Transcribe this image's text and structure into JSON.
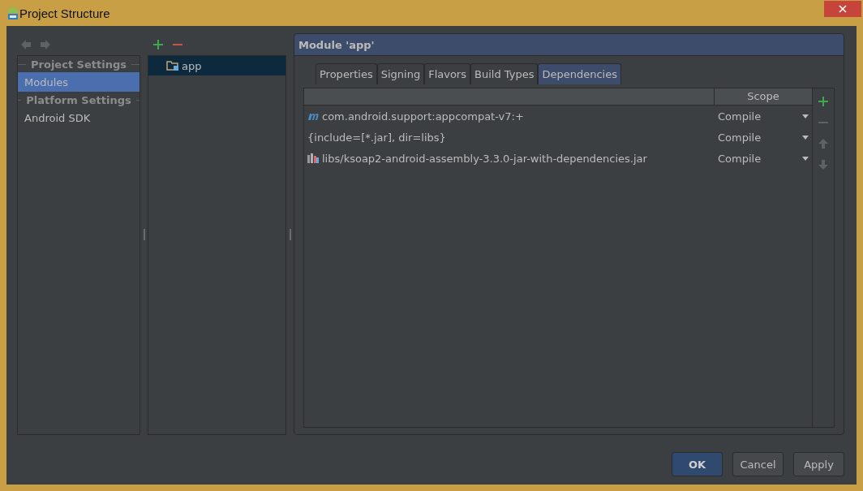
{
  "window": {
    "title": "Project Structure"
  },
  "navigation": [
    {
      "kind": "back",
      "disabled": true
    },
    {
      "kind": "forward",
      "disabled": true
    }
  ],
  "sidebar": {
    "sections": [
      {
        "heading": "Project Settings",
        "items": [
          {
            "label": "Modules",
            "selected": true
          }
        ]
      },
      {
        "heading": "Platform Settings",
        "items": [
          {
            "label": "Android SDK",
            "selected": false
          }
        ]
      }
    ]
  },
  "module_actions": [
    {
      "kind": "add",
      "disabled": false
    },
    {
      "kind": "remove",
      "disabled": false
    }
  ],
  "modules": [
    {
      "label": "app",
      "selected": true
    }
  ],
  "module_panel": {
    "title": "Module 'app'",
    "tabs": [
      {
        "label": "Properties",
        "selected": false
      },
      {
        "label": "Signing",
        "selected": false
      },
      {
        "label": "Flavors",
        "selected": false
      },
      {
        "label": "Build Types",
        "selected": false
      },
      {
        "label": "Dependencies",
        "selected": true
      }
    ],
    "table": {
      "columns": [
        "Scope"
      ],
      "rows": [
        {
          "kind": "maven",
          "name": "com.android.support:appcompat-v7:+",
          "scope": "Compile"
        },
        {
          "kind": "plain",
          "name": "{include=[*.jar], dir=libs}",
          "scope": "Compile"
        },
        {
          "kind": "jar",
          "name": "libs/ksoap2-android-assembly-3.3.0-jar-with-dependencies.jar",
          "scope": "Compile"
        }
      ]
    },
    "table_actions": [
      {
        "kind": "add",
        "disabled": false
      },
      {
        "kind": "remove",
        "disabled": true
      },
      {
        "kind": "up",
        "disabled": true
      },
      {
        "kind": "down",
        "disabled": true
      }
    ]
  },
  "buttons": [
    {
      "label": "OK",
      "default": true
    },
    {
      "label": "Cancel",
      "default": false
    },
    {
      "label": "Apply",
      "default": false
    }
  ]
}
